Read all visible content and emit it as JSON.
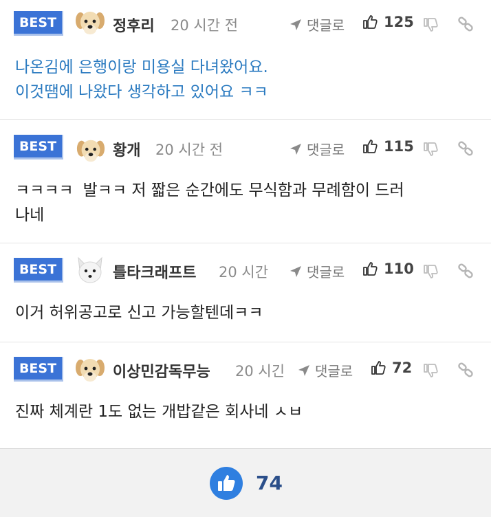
{
  "comments": [
    {
      "badge": "BEST",
      "avatar_icon": "puppy-avatar-icon",
      "name": "정후리",
      "time": "20 시간 전",
      "reply_label": "댓글로",
      "likes": "125",
      "text_line1": "나온김에 은행이랑 미용실 다녀왔어요.",
      "text_line2": "이것땜에 나왔다 생각하고 있어요 ㅋㅋ",
      "text_color": "#2a7ac0"
    },
    {
      "badge": "BEST",
      "avatar_icon": "puppy-avatar-icon",
      "name": "황개",
      "time": "20 시간 전",
      "reply_label": "댓글로",
      "likes": "115",
      "text_line1_a": "ㅋㅋㅋㅋ",
      "text_line1_b": "발ㅋㅋ 저 짧은 순간에도 무식함과 무례함이 드러",
      "text_line2": "나네"
    },
    {
      "badge": "BEST",
      "avatar_icon": "white-fox-avatar-icon",
      "name": "틀타크래프트",
      "time": "20 시간",
      "reply_label": "댓글로",
      "likes": "110",
      "text_line1": "이거 허위공고로 신고 가능할텐데ㅋㅋ"
    },
    {
      "badge": "BEST",
      "avatar_icon": "puppy-avatar-icon",
      "name": "이상민감독무능",
      "time": "20 시긴",
      "reply_label": "댓글로",
      "likes": "72",
      "text_line1": "진짜 체계란 1도 없는 개밥같은 회사네 ㅅㅂ"
    }
  ],
  "footer": {
    "like_icon": "thumbs-up-circle-icon",
    "like_count": "74"
  },
  "colors": {
    "badge": "#3b73d6",
    "blue_text": "#2a7ac0",
    "like_count": "#2b4f8a"
  }
}
